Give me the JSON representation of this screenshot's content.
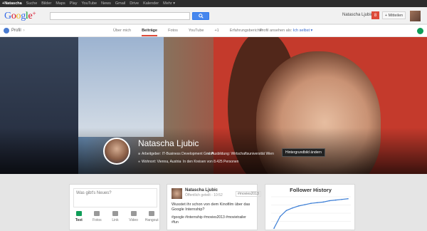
{
  "topbar": {
    "items": [
      "+Natascha",
      "Suche",
      "Bilder",
      "Maps",
      "Play",
      "YouTube",
      "News",
      "Gmail",
      "Drive",
      "Kalender",
      "Mehr ▾"
    ]
  },
  "header": {
    "logo": "Google+",
    "user_name": "Natascha Ljubic",
    "notification_count": "8",
    "share_label": "+ Mitteilen"
  },
  "navbar": {
    "profile_label": "Profil",
    "tabs": [
      "Über mich",
      "Beiträge",
      "Fotos",
      "YouTube",
      "+1",
      "Erfahrungsberichte"
    ],
    "selected_tab": "Beiträge",
    "view_as_label": "Profil ansehen als:",
    "view_as_value": "Ich selbst"
  },
  "profile": {
    "name": "Natascha Ljubic",
    "job": "Arbeitgeber: IT-Business Development GmbH",
    "education": "Ausbildung: Wirtschaftsuniversität Wien",
    "location": "Wohnort: Vienna, Austria",
    "circles": "In den Kreisen von 8.425 Personen",
    "background_button": "Hintergrundbild ändern"
  },
  "composer": {
    "placeholder": "Was gibt's Neues?",
    "actions": [
      "Text",
      "Fotos",
      "Link",
      "Video",
      "Hangout"
    ]
  },
  "post": {
    "author": "Natascha Ljubic",
    "visibility": "Öffentlich geteilt",
    "time": "10:52",
    "tag": "#movies2013",
    "text": "Wusstet ihr schon von dem Kinofilm über das Google Internship?",
    "hashtags": "#google #internship #movies2013 #movietrailer #fun"
  },
  "chart_data": {
    "type": "line",
    "title": "Follower History",
    "xlabel": "",
    "ylabel": "",
    "x": [
      0,
      1,
      2,
      3,
      4,
      5,
      6,
      7,
      8,
      9,
      10,
      11,
      12
    ],
    "series": [
      {
        "values": [
          2,
          20,
          29,
          33,
          36,
          38,
          40,
          41,
          42,
          44,
          45,
          46,
          47
        ]
      }
    ],
    "ylim": [
      0,
      50
    ],
    "grid": true,
    "colors": {
      "line": "#3d7fd6"
    }
  }
}
